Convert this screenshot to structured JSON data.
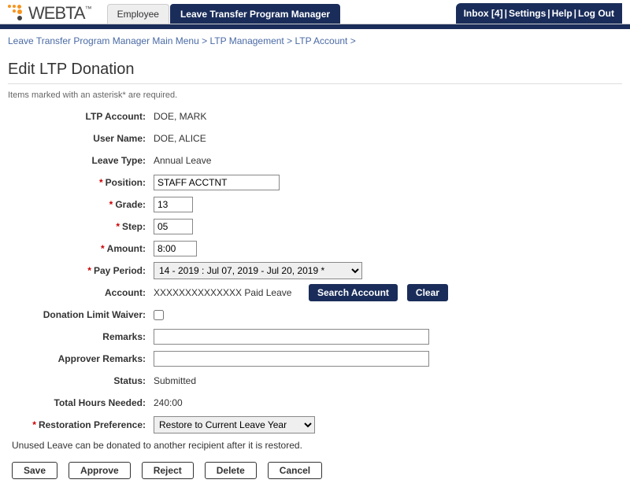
{
  "logo": {
    "text": "WEBTA",
    "tm": "™"
  },
  "tabs": {
    "employee": "Employee",
    "manager": "Leave Transfer Program Manager"
  },
  "topnav": {
    "inbox": "Inbox [4]",
    "settings": "Settings",
    "help": "Help",
    "logout": "Log Out",
    "sep": " | "
  },
  "breadcrumb": {
    "a": "Leave Transfer Program Manager Main Menu",
    "b": "LTP Management",
    "c": "LTP Account",
    "sep": " > "
  },
  "page": {
    "title": "Edit LTP Donation",
    "hint": "Items marked with an asterisk* are required."
  },
  "form": {
    "labels": {
      "ltp_account": "LTP Account:",
      "user_name": "User Name:",
      "leave_type": "Leave Type:",
      "position": "Position:",
      "grade": "Grade:",
      "step": "Step:",
      "amount": "Amount:",
      "pay_period": "Pay Period:",
      "account": "Account:",
      "donation_limit_waiver": "Donation Limit Waiver:",
      "remarks": "Remarks:",
      "approver_remarks": "Approver Remarks:",
      "status": "Status:",
      "total_hours_needed": "Total Hours Needed:",
      "restoration_preference": "Restoration Preference:"
    },
    "values": {
      "ltp_account": "DOE, MARK",
      "user_name": "DOE, ALICE",
      "leave_type": "Annual Leave",
      "position": "STAFF ACCTNT",
      "grade": "13",
      "step": "05",
      "amount": "8:00",
      "pay_period": "14 - 2019 : Jul 07, 2019 - Jul 20, 2019 *",
      "account": "XXXXXXXXXXXXXX Paid Leave",
      "remarks": "",
      "approver_remarks": "",
      "status": "Submitted",
      "total_hours_needed": "240:00",
      "restoration_preference": "Restore to Current Leave Year"
    },
    "note": "Unused Leave can be donated to another recipient after it is restored."
  },
  "buttons": {
    "search_account": "Search Account",
    "clear": "Clear",
    "save": "Save",
    "approve": "Approve",
    "reject": "Reject",
    "delete": "Delete",
    "cancel": "Cancel"
  }
}
